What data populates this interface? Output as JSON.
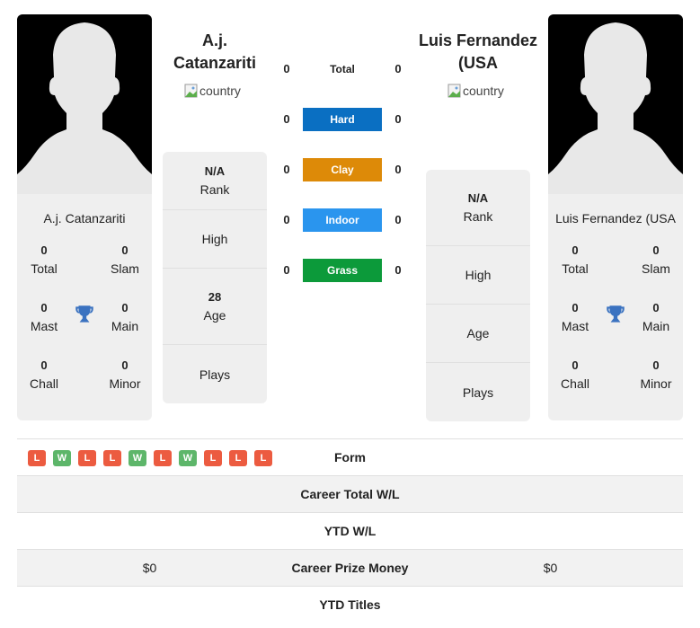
{
  "colors": {
    "hard": "#0a6fc2",
    "clay": "#dd8a08",
    "indoor": "#2a95ee",
    "grass": "#0c9a3a",
    "win": "#5db66a",
    "loss": "#ec5b40",
    "trophy": "#3a72c0"
  },
  "player1": {
    "name": "A.j. Catanzariti",
    "flag_alt": "country",
    "card_name": "A.j. Catanzariti",
    "titles": {
      "total": {
        "value": "0",
        "label": "Total"
      },
      "slam": {
        "value": "0",
        "label": "Slam"
      },
      "mast": {
        "value": "0",
        "label": "Mast"
      },
      "main": {
        "value": "0",
        "label": "Main"
      },
      "chall": {
        "value": "0",
        "label": "Chall"
      },
      "minor": {
        "value": "0",
        "label": "Minor"
      }
    },
    "info": {
      "rank": {
        "value": "N/A",
        "label": "Rank"
      },
      "high": {
        "value": "",
        "label": "High"
      },
      "age": {
        "value": "28",
        "label": "Age"
      },
      "plays": {
        "value": "",
        "label": "Plays"
      }
    }
  },
  "player2": {
    "name": "Luis Fernandez (USA",
    "flag_alt": "country",
    "card_name": "Luis Fernandez (USA",
    "titles": {
      "total": {
        "value": "0",
        "label": "Total"
      },
      "slam": {
        "value": "0",
        "label": "Slam"
      },
      "mast": {
        "value": "0",
        "label": "Mast"
      },
      "main": {
        "value": "0",
        "label": "Main"
      },
      "chall": {
        "value": "0",
        "label": "Chall"
      },
      "minor": {
        "value": "0",
        "label": "Minor"
      }
    },
    "info": {
      "rank": {
        "value": "N/A",
        "label": "Rank"
      },
      "high": {
        "value": "",
        "label": "High"
      },
      "age": {
        "value": "",
        "label": "Age"
      },
      "plays": {
        "value": "",
        "label": "Plays"
      }
    }
  },
  "surfaces": [
    {
      "label": "Total",
      "p1": "0",
      "p2": "0"
    },
    {
      "label": "Hard",
      "p1": "0",
      "p2": "0"
    },
    {
      "label": "Clay",
      "p1": "0",
      "p2": "0"
    },
    {
      "label": "Indoor",
      "p1": "0",
      "p2": "0"
    },
    {
      "label": "Grass",
      "p1": "0",
      "p2": "0"
    }
  ],
  "table": {
    "form_label": "Form",
    "form": [
      "L",
      "W",
      "L",
      "L",
      "W",
      "L",
      "W",
      "L",
      "L",
      "L"
    ],
    "rows": [
      {
        "label": "Career Total W/L",
        "p1": "",
        "p2": ""
      },
      {
        "label": "YTD W/L",
        "p1": "",
        "p2": ""
      },
      {
        "label": "Career Prize Money",
        "p1": "$0",
        "p2": "$0"
      },
      {
        "label": "YTD Titles",
        "p1": "",
        "p2": ""
      }
    ]
  }
}
